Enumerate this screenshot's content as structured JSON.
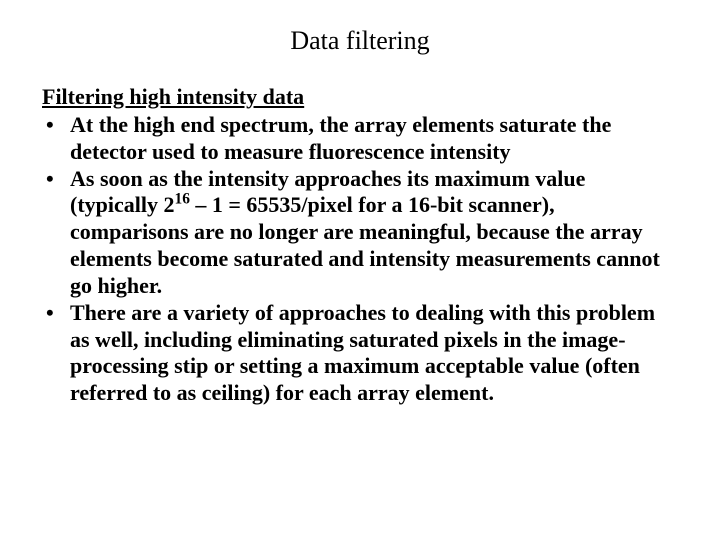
{
  "title": "Data filtering",
  "heading": "Filtering high intensity data",
  "bullets": [
    {
      "pre": "At the high end spectrum, ",
      "bold1": "the array elements saturate ",
      "post1": "the detector used to measure fluorescence intensity"
    },
    {
      "pre": "As soon as ",
      "bold1": "the intensity approaches its maximum value ",
      "post1": "(typically 2",
      "sup": "16",
      "post2": " – 1 = 65535/pixel for a 16-bit scanner), comparisons are no longer are meaningful, because the array elements become saturated and intensity measurements cannot go higher."
    },
    {
      "pre": "There are a variety of approaches to dealing with this problem as well, including eliminating saturated pixels in the image-processing stip or setting a maximum acceptable value (often referred to as ceiling) for each array element."
    }
  ]
}
